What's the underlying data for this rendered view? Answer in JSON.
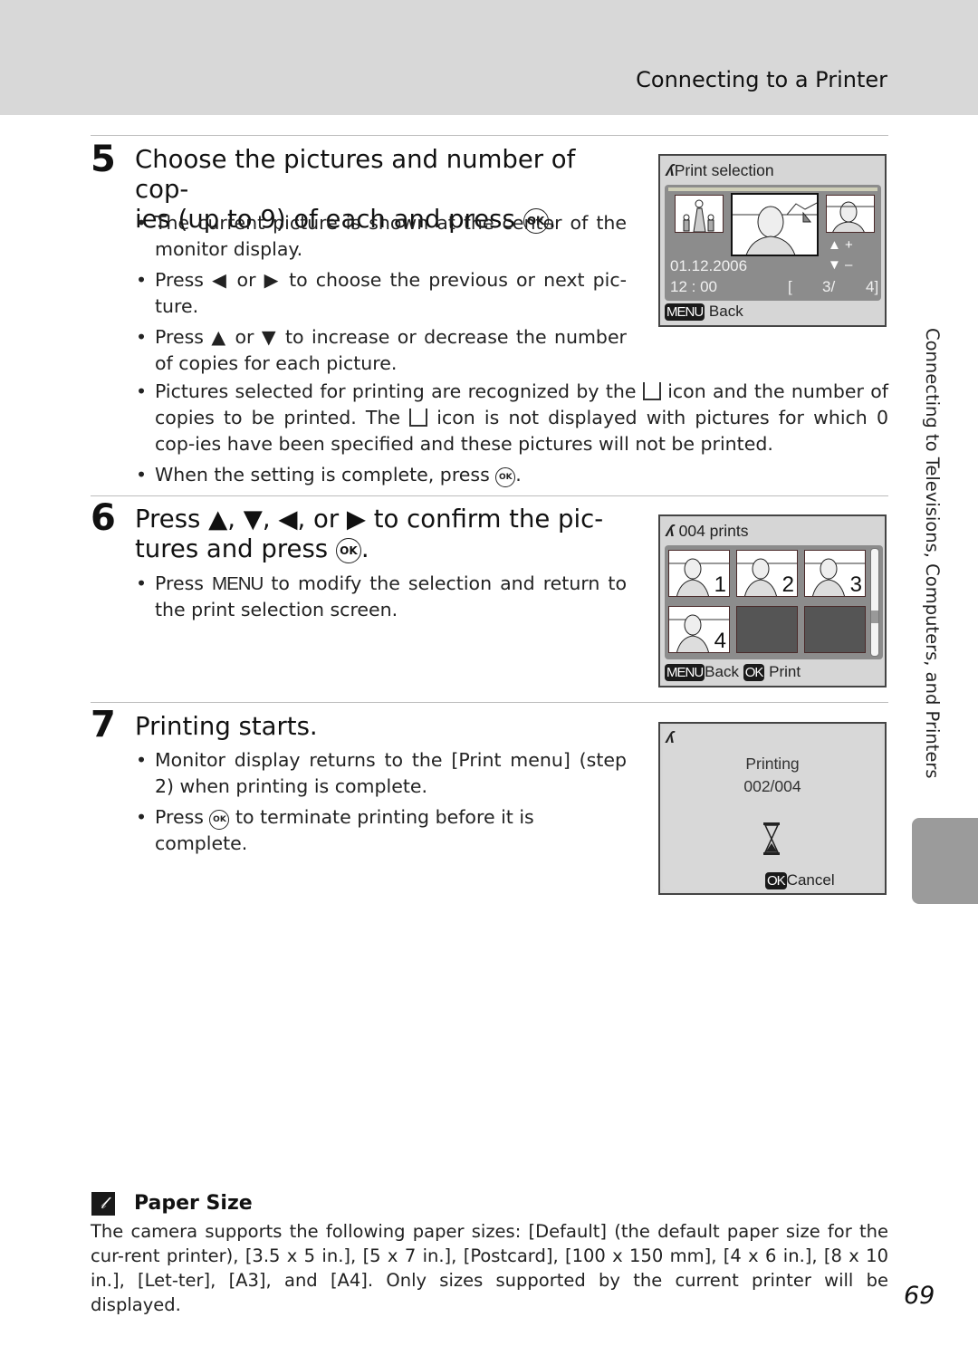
{
  "header": {
    "section_title": "Connecting to a Printer"
  },
  "steps": [
    {
      "number": "5",
      "title_line1": "Choose the pictures and number of cop-",
      "title_line2": "ies (up to 9) of each and press",
      "title_icon": "ok-button-icon",
      "bullets": [
        "The current picture is shown at the center of the monitor display.",
        "Press ◀ or ▶ to choose the previous or next picture.",
        "Press ▲ or ▼ to increase or decrease the number of copies for each picture.",
        "Pictures selected for printing are recognized by the [print] icon and the number of copies to be printed. The [print] icon is not displayed with pictures for which 0 copies have been specified and these pictures will not be printed.",
        "When the setting is complete, press OK."
      ],
      "bullet_parts": {
        "b1": "The current picture is shown at the center of the monitor display.",
        "b2_a": "Press ",
        "b2_left": "◀",
        "b2_or": " or ",
        "b2_right": "▶",
        "b2_b": "  to choose the previous or next pic-ture.",
        "b3_a": "Press ",
        "b3_up": "▲",
        "b3_or": " or ",
        "b3_down": "▼",
        "b3_b": " to increase or decrease the number of copies for each picture.",
        "b4_a": "Pictures selected for printing are recognized by the ",
        "b4_b": " icon and the number of copies to be printed. The ",
        "b4_c": " icon is not displayed with pictures for which 0 cop-ies have been specified and these pictures will not be printed.",
        "b5_a": "When the setting is complete, press ",
        "b5_b": "."
      },
      "screen": {
        "title": "Print selection",
        "date": "01.12.2006",
        "time": "12 : 00",
        "plus": "+",
        "minus": "–",
        "counter_open": "[",
        "counter_value": "3/",
        "counter_total": "4]",
        "menu_chip": "MENU",
        "back_label": "Back"
      }
    },
    {
      "number": "6",
      "title_a": "Press ▲, ▼, ◀, or ▶  to confirm the pic-",
      "title_b": "tures and press",
      "bullet_parts": {
        "b1_a": "Press ",
        "b1_menu": "MENU",
        "b1_b": " to modify the selection and return to the print selection screen."
      },
      "screen": {
        "title": "004 prints",
        "thumbs": [
          {
            "copies": "1",
            "empty": false
          },
          {
            "copies": "2",
            "empty": false
          },
          {
            "copies": "3",
            "empty": false
          },
          {
            "copies": "4",
            "empty": false
          },
          {
            "copies": "",
            "empty": true
          },
          {
            "copies": "",
            "empty": true
          }
        ],
        "menu_chip": "MENU",
        "back_label": "Back",
        "ok_chip": "OK",
        "print_label": "Print"
      }
    },
    {
      "number": "7",
      "title": "Printing starts.",
      "bullet_parts": {
        "b1": "Monitor display returns to the [Print menu] (step 2) when printing is complete.",
        "b2_a": "Press ",
        "b2_b": " to terminate printing before it is complete."
      },
      "screen": {
        "status": "Printing",
        "progress": "002/004",
        "progress_fraction": 0.5,
        "ok_chip": "OK",
        "cancel_label": "Cancel"
      }
    }
  ],
  "sidebar": {
    "chapter_label": "Connecting to Televisions, Computers, and Printers"
  },
  "note": {
    "title": "Paper Size",
    "body": "The camera supports the following paper sizes: [Default] (the default paper size for the cur-rent printer), [3.5 x 5 in.], [5 x 7 in.], [Postcard], [100 x 150 mm], [4 x 6 in.], [8 x 10 in.], [Let-ter], [A3], and [A4]. Only sizes supported by the current printer will be displayed."
  },
  "page_number": "69",
  "glyphs": {
    "ok": "OK"
  }
}
